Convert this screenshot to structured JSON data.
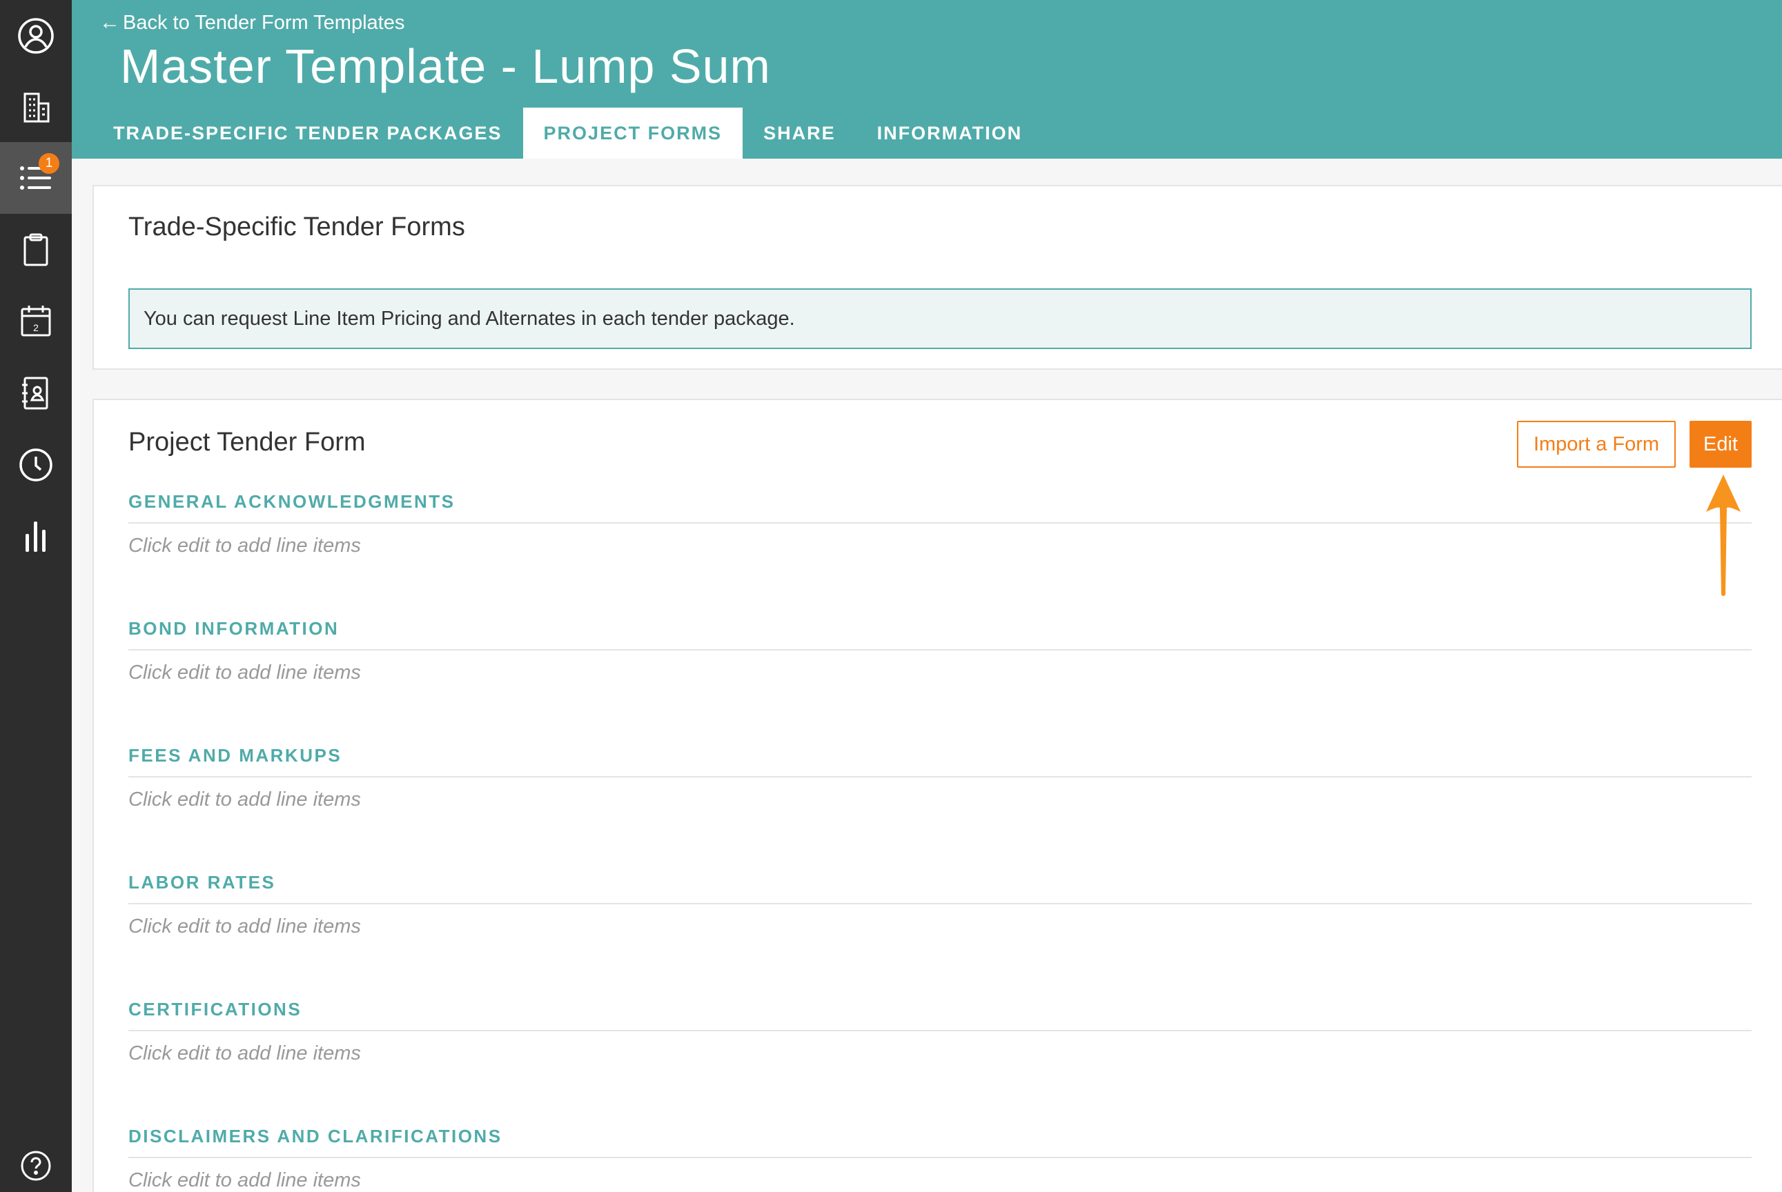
{
  "sidebar": {
    "items": [
      {
        "icon": "user-circle-icon"
      },
      {
        "icon": "building-icon"
      },
      {
        "icon": "list-icon",
        "badge": "1",
        "active": true
      },
      {
        "icon": "clipboard-icon"
      },
      {
        "icon": "calendar-icon",
        "day": "2"
      },
      {
        "icon": "address-book-icon"
      },
      {
        "icon": "clock-icon"
      },
      {
        "icon": "bar-chart-icon"
      },
      {
        "icon": "help-icon"
      }
    ]
  },
  "header": {
    "back_label": "Back to Tender Form Templates",
    "title": "Master Template - Lump Sum",
    "tabs": [
      {
        "label": "TRADE-SPECIFIC TENDER PACKAGES",
        "active": false
      },
      {
        "label": "PROJECT FORMS",
        "active": true
      },
      {
        "label": "SHARE",
        "active": false
      },
      {
        "label": "INFORMATION",
        "active": false
      }
    ]
  },
  "trade_forms": {
    "title": "Trade-Specific Tender Forms",
    "info": "You can request Line Item Pricing and Alternates in each tender package."
  },
  "project_form": {
    "title": "Project Tender Form",
    "import_label": "Import a Form",
    "edit_label": "Edit",
    "sections": [
      {
        "heading": "GENERAL ACKNOWLEDGMENTS",
        "empty": "Click edit to add line items"
      },
      {
        "heading": "BOND INFORMATION",
        "empty": "Click edit to add line items"
      },
      {
        "heading": "FEES AND MARKUPS",
        "empty": "Click edit to add line items"
      },
      {
        "heading": "LABOR RATES",
        "empty": "Click edit to add line items"
      },
      {
        "heading": "CERTIFICATIONS",
        "empty": "Click edit to add line items"
      },
      {
        "heading": "DISCLAIMERS AND CLARIFICATIONS",
        "empty": "Click edit to add line items"
      }
    ]
  },
  "colors": {
    "teal": "#4faba9",
    "orange": "#f47e16",
    "sidebar": "#2d2d2d",
    "arrow": "#f7941d"
  }
}
